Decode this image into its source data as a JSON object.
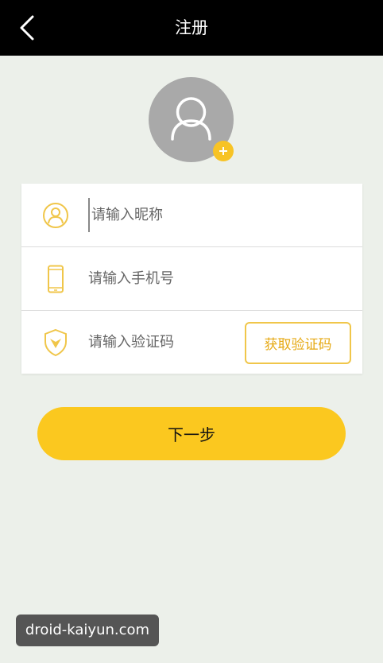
{
  "header": {
    "title": "注册",
    "back_icon": "chevron-left-icon"
  },
  "avatar": {
    "icon": "user-icon",
    "add_icon": "plus-icon",
    "placeholder_color": "#a9a9a9"
  },
  "form": {
    "nickname": {
      "icon": "user-circle-icon",
      "placeholder": "请输入昵称",
      "value": ""
    },
    "phone": {
      "icon": "phone-icon",
      "placeholder": "请输入手机号",
      "value": ""
    },
    "code": {
      "icon": "shield-icon",
      "placeholder": "请输入验证码",
      "value": "",
      "button_label": "获取验证码"
    }
  },
  "actions": {
    "next_label": "下一步"
  },
  "watermark": {
    "text": "droid-kaiyun.com"
  },
  "colors": {
    "accent": "#fbc81f",
    "header_bg": "#000000",
    "page_bg": "#ecf0ea",
    "icon_yellow": "#f0c64a"
  }
}
